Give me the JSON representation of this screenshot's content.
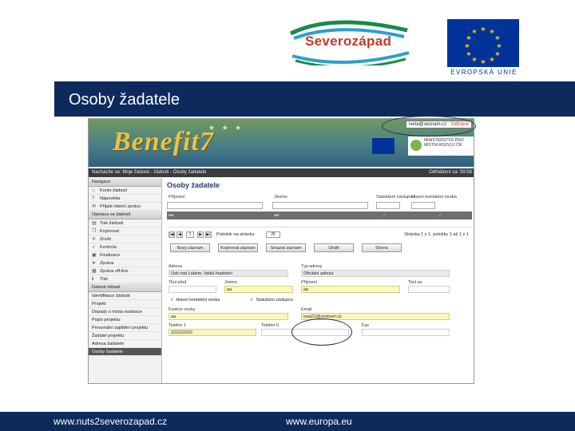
{
  "logos": {
    "severozapad": "Severozápad",
    "eu_caption": "EVROPSKÁ UNIE"
  },
  "slide_title": "Osoby žadatele",
  "app": {
    "brand": "Benefit7",
    "user_email": "iveta@seznam.cz",
    "logout_link": "Odhlásit",
    "ministry": "MINISTERSTVO PRO MÍSTNÍ ROZVOJ ČR",
    "breadcrumb": "Nacházíte se: Moje žádosti - žádosti - Osoby žadatele",
    "session_timer": "Odhlášení za: 59:58",
    "sidebar": {
      "sections": [
        {
          "title": "Navigace",
          "items": [
            {
              "icon": "house-icon",
              "glyph": "⌂",
              "label": "Konto žádostí"
            },
            {
              "icon": "help-icon",
              "glyph": "?",
              "label": "Nápověda"
            },
            {
              "icon": "message-icon",
              "glyph": "✉",
              "label": "Přijaté interní zprávy"
            }
          ]
        },
        {
          "title": "Operace se žádostí",
          "items": [
            {
              "icon": "print-icon",
              "glyph": "▤",
              "label": "Tisk žádosti"
            },
            {
              "icon": "copy-icon",
              "glyph": "❐",
              "label": "Kopírovat"
            },
            {
              "icon": "delete-icon",
              "glyph": "✕",
              "label": "Zrušit"
            },
            {
              "icon": "check-icon",
              "glyph": "✓",
              "label": "Kontrola"
            },
            {
              "icon": "finalize-icon",
              "glyph": "▣",
              "label": "Finalizace"
            },
            {
              "icon": "send-icon",
              "glyph": "➤",
              "label": "Zpráva"
            },
            {
              "icon": "offline-icon",
              "glyph": "▦",
              "label": "Zpráva off-line"
            },
            {
              "icon": "info-icon",
              "glyph": "ℹ",
              "label": "Tisk"
            }
          ]
        },
        {
          "title": "Datové oblasti",
          "items": [
            {
              "label": "Identifikace žádosti",
              "active": false
            },
            {
              "label": "Projekt",
              "active": false
            },
            {
              "label": "Dopady s místa realizace",
              "active": false
            },
            {
              "label": "Popis projektu",
              "active": false
            },
            {
              "label": "Personální zajištění projektu",
              "active": false
            },
            {
              "label": "Žadatel projektu",
              "active": false
            },
            {
              "label": "Adresa žadatele",
              "active": false
            },
            {
              "label": "Osoby žadatele",
              "active": true
            }
          ]
        }
      ]
    },
    "main": {
      "heading": "Osoby žadatele",
      "columns": [
        "Příjmení",
        "Jméno",
        "Statutární zástupce",
        "Hlavní kontaktní osoba"
      ],
      "row": {
        "surname": "aa",
        "name": "aa",
        "statutory": "✓",
        "main_contact": "✓"
      },
      "pager": {
        "current_page": "1",
        "per_page_label": "Položek na stránku",
        "per_page_value": "25",
        "summary": "Stránka 1 z 1, položky 1 až 1 z 1"
      },
      "buttons": {
        "new": "Nový záznam",
        "copy": "Kopírovat záznam",
        "delete": "Smazat záznam",
        "save": "Uložit",
        "cancel": "Storno"
      },
      "form": {
        "address_label": "Adresa",
        "address_value": "Ústí nad Labem, Velká hradební",
        "address_type_label": "Typ adresy",
        "address_type_value": "Oficiální adresa",
        "title_before_label": "Titul před",
        "name_label": "Jméno",
        "name_value": "aa",
        "surname_label": "Příjmení",
        "surname_value": "aa",
        "title_after_label": "Titul za",
        "main_contact_check": "Hlavní kontaktní osoba",
        "statutory_check": "Statutární zástupce",
        "function_label": "Funkce osoby",
        "function_value": "aa",
        "email_label": "Email",
        "email_value": "ivaa21@centrum.cz",
        "phone1_label": "Telefon 1",
        "phone1_value": "222222222",
        "phone2_label": "Telefon II.",
        "fax_label": "Fax"
      }
    }
  },
  "footer": {
    "url_left": "www.nuts2severozapad.cz",
    "url_right": "www.europa.eu"
  },
  "colors": {
    "navy": "#0d2a5c",
    "eu_blue": "#003399",
    "required_field": "#fbf6bd"
  }
}
